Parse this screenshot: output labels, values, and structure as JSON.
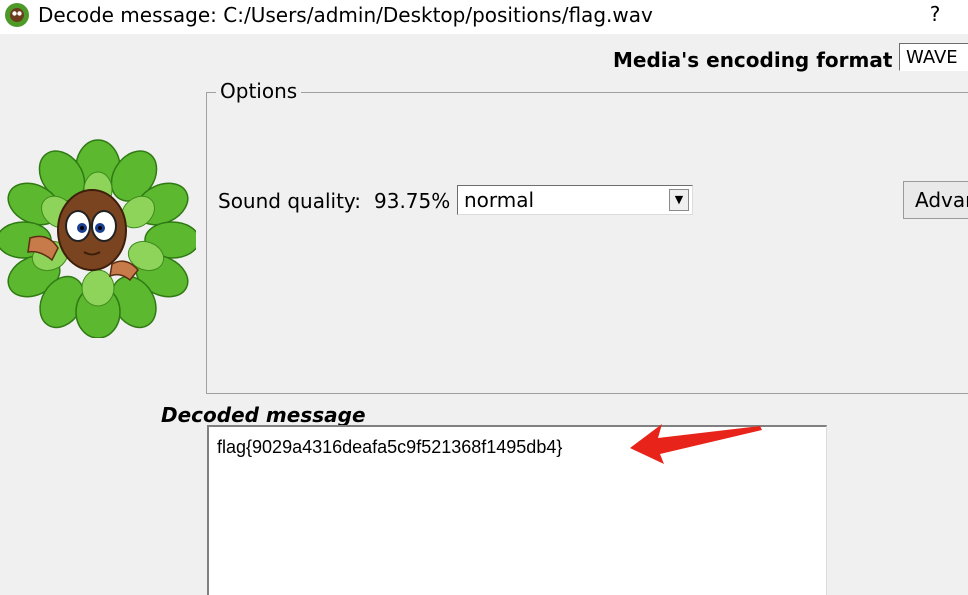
{
  "window": {
    "title": "Decode message: C:/Users/admin/Desktop/positions/flag.wav",
    "help_label": "?"
  },
  "format": {
    "label": "Media's encoding format :",
    "value": "WAVE"
  },
  "options": {
    "legend": "Options",
    "sound_quality_label": "Sound quality:",
    "sound_quality_value": "93.75%",
    "quality_selected": "normal",
    "advanced_label": "Advanced"
  },
  "decoded": {
    "label": "Decoded message",
    "message": "flag{9029a4316deafa5c9f521368f1495db4}"
  },
  "colors": {
    "annotation_arrow": "#e8231a",
    "leaf_green": "#5cb82e"
  }
}
